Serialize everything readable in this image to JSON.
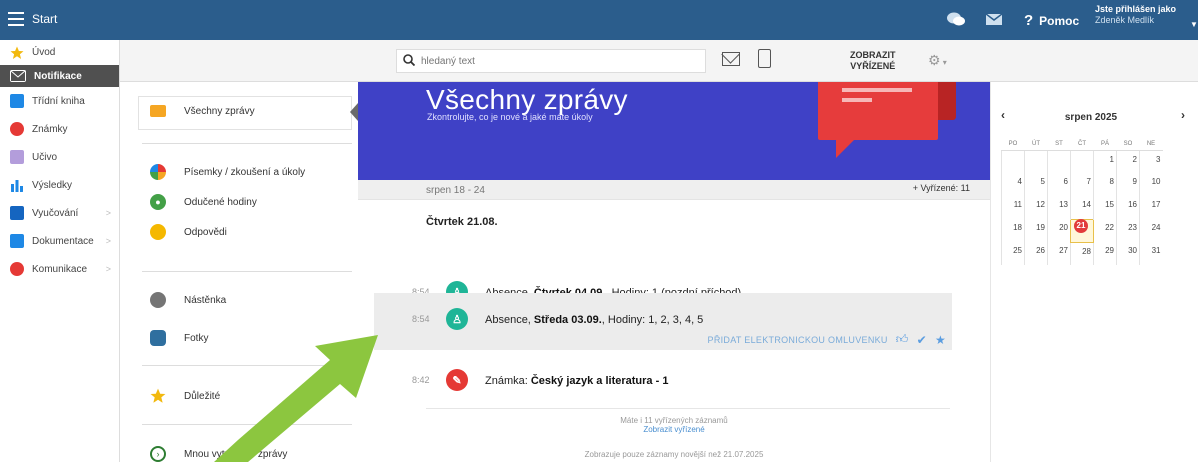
{
  "topbar": {
    "title": "Start",
    "help_label": "Pomoc",
    "user_line1": "Jste přihlášen jako",
    "user_line2": "Zdeněk Medlík"
  },
  "leftnav": {
    "items": [
      {
        "label": "Úvod",
        "icon": "star-icon",
        "color": "#f2b90f"
      },
      {
        "label": "Notifikace",
        "icon": "mail-icon",
        "color": "#ffffff",
        "active": true
      },
      {
        "label": "Třídní kniha",
        "icon": "book-icon",
        "color": "#1e88e5"
      },
      {
        "label": "Známky",
        "icon": "grade-icon",
        "color": "#e53935"
      },
      {
        "label": "Učivo",
        "icon": "teacher-icon",
        "color": "#7e57c2"
      },
      {
        "label": "Výsledky",
        "icon": "bar-chart-icon",
        "color": "#1e88e5"
      },
      {
        "label": "Vyučování",
        "icon": "school-icon",
        "color": "#1565c0"
      },
      {
        "label": "Dokumentace",
        "icon": "document-icon",
        "color": "#1e88e5"
      },
      {
        "label": "Komunikace",
        "icon": "people-icon",
        "color": "#e53935"
      }
    ]
  },
  "toolbar": {
    "search_placeholder": "hledaný text",
    "show_done_line1": "ZOBRAZIT",
    "show_done_line2": "VYŘÍZENÉ"
  },
  "categories": {
    "selected": "Všechny zprávy",
    "group1": [
      "Písemky / zkoušení a úkoly",
      "Odučené hodiny",
      "Odpovědi"
    ],
    "group2": [
      "Nástěnka",
      "Fotky"
    ],
    "group3": [
      "Důležité"
    ],
    "group4": [
      "Mnou vytvořené zprávy"
    ]
  },
  "banner": {
    "title": "Všechny zprávy",
    "subtitle": "Zkontrolujte, co je nové a jaké máte úkoly"
  },
  "week": {
    "range": "srpen 18 - 24",
    "done": "+ Vyřízené: 11"
  },
  "day_heading": "Čtvrtek 21.08.",
  "messages": [
    {
      "time": "8:54",
      "pre": "Absence, ",
      "bold": "Čtvrtek 04.09.",
      "post": ", Hodiny: 1 (pozdní příchod)",
      "color": "#1fb597"
    },
    {
      "time": "8:54",
      "pre": "Absence, ",
      "bold": "Středa 03.09.",
      "post": ", Hodiny: 1, 2, 3, 4, 5",
      "color": "#1fb597",
      "action": "PŘIDAT ELEKTRONICKOU OMLUVENKU"
    },
    {
      "time": "8:42",
      "pre": "Známka: ",
      "bold": "Český jazyk a literatura - 1",
      "post": "",
      "color": "#e53935"
    }
  ],
  "footer": {
    "count_text": "Máte i 11 vyřízených záznamů",
    "show_done_link": "Zobrazit vyřízené",
    "note": "Zobrazuje pouze záznamy novější než 21.07.2025"
  },
  "calendar": {
    "month": "srpen 2025",
    "weekdays": [
      "PO",
      "ÚT",
      "ST",
      "ČT",
      "PÁ",
      "SO",
      "NE"
    ],
    "weeks": [
      [
        "",
        "",
        "",
        "",
        "1",
        "2",
        "3"
      ],
      [
        "4",
        "5",
        "6",
        "7",
        "8",
        "9",
        "10"
      ],
      [
        "11",
        "12",
        "13",
        "14",
        "15",
        "16",
        "17"
      ],
      [
        "18",
        "19",
        "20",
        "21",
        "22",
        "23",
        "24"
      ],
      [
        "25",
        "26",
        "27",
        "28",
        "29",
        "30",
        "31"
      ]
    ],
    "today": "21"
  },
  "colors": {
    "topbar": "#2b5d8c",
    "banner": "#3f41c6",
    "accent_red": "#e63c3c",
    "arrow_green": "#8cc63f"
  }
}
